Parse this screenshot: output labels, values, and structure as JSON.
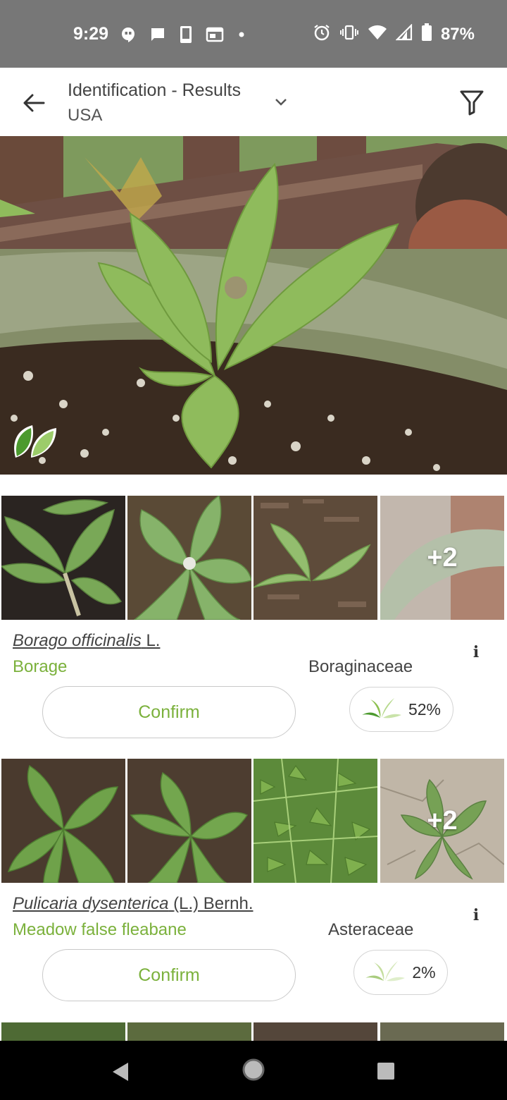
{
  "status_bar": {
    "time": "9:29",
    "battery": "87%",
    "left_icons": [
      "hangouts-icon",
      "message-icon",
      "phone-icon",
      "calendar-icon",
      "dot-icon"
    ],
    "right_icons": [
      "alarm-icon",
      "vibrate-icon",
      "wifi-icon",
      "signal-icon",
      "battery-icon"
    ]
  },
  "header": {
    "title": "Identification - Results",
    "subtitle": "USA"
  },
  "results": [
    {
      "scientific_name": "Borago officinalis",
      "author": "L.",
      "common_name": "Borage",
      "family": "Boraginaceae",
      "confirm_label": "Confirm",
      "score": "52%",
      "more_photos": "+2"
    },
    {
      "scientific_name": "Pulicaria dysenterica",
      "author": "(L.) Bernh.",
      "common_name": "Meadow false fleabane",
      "family": "Asteraceae",
      "confirm_label": "Confirm",
      "score": "2%",
      "more_photos": "+2"
    }
  ],
  "colors": {
    "accent_green": "#7bb13c",
    "status_bar": "#777777",
    "nav_bar": "#000000"
  }
}
